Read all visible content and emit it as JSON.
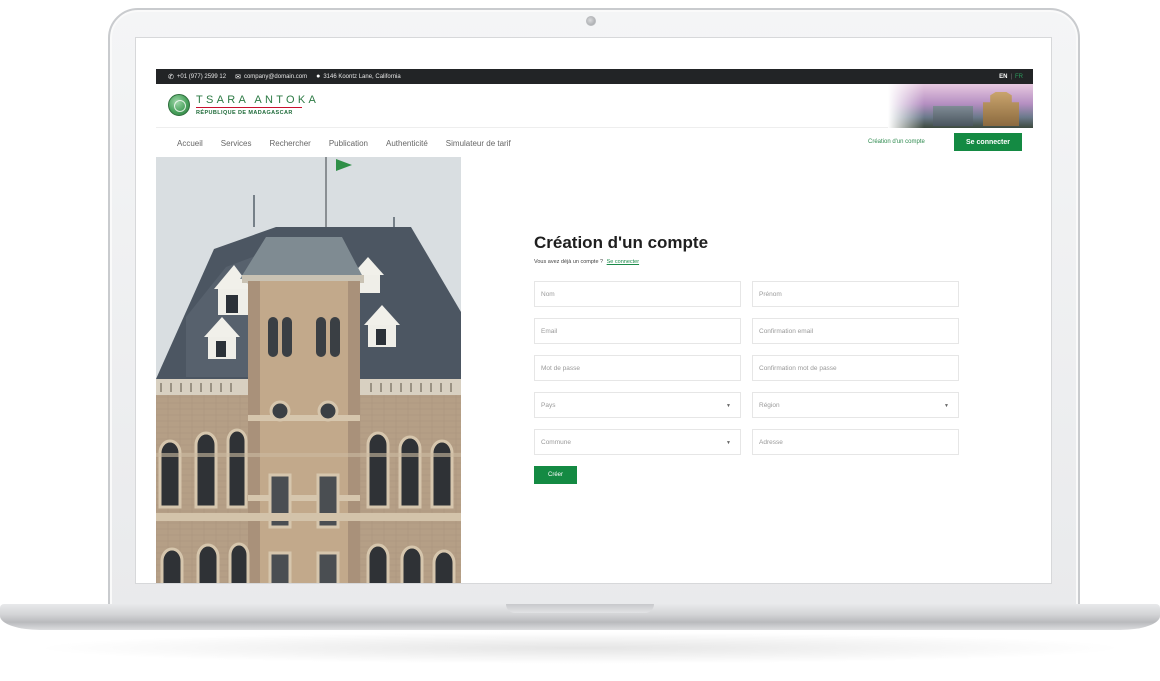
{
  "topbar": {
    "phone": "+01 (977) 2599 12",
    "email": "company@domain.com",
    "address": "3146 Koontz Lane, California",
    "lang_active": "EN",
    "lang_separator": "|",
    "lang_other": "FR",
    "icons": {
      "phone": "phone-icon",
      "email": "envelope-icon",
      "address": "map-pin-icon"
    }
  },
  "header": {
    "brand": "TSARA ANTOKA",
    "subtitle": "RÉPUBLIQUE DE MADAGASCAR"
  },
  "nav": {
    "items": [
      "Accueil",
      "Services",
      "Rechercher",
      "Publication",
      "Authenticité",
      "Simulateur de tarif"
    ],
    "create_account": "Création d'un compte",
    "login": "Se connecter"
  },
  "form": {
    "title": "Création d'un compte",
    "subtitle": "Vous avez déjà un compte ?",
    "subtitle_link": "Se connecter",
    "fields": {
      "nom": "Nom",
      "prenom": "Prénom",
      "email": "Email",
      "email_confirm": "Confirmation email",
      "password": "Mot de passe",
      "password_confirm": "Confirmation mot de passe",
      "pays": "Pays",
      "region": "Région",
      "commune": "Commune",
      "adresse": "Adresse"
    },
    "submit": "Créer"
  },
  "colors": {
    "primary_green": "#148a43",
    "topbar_bg": "#222426"
  }
}
